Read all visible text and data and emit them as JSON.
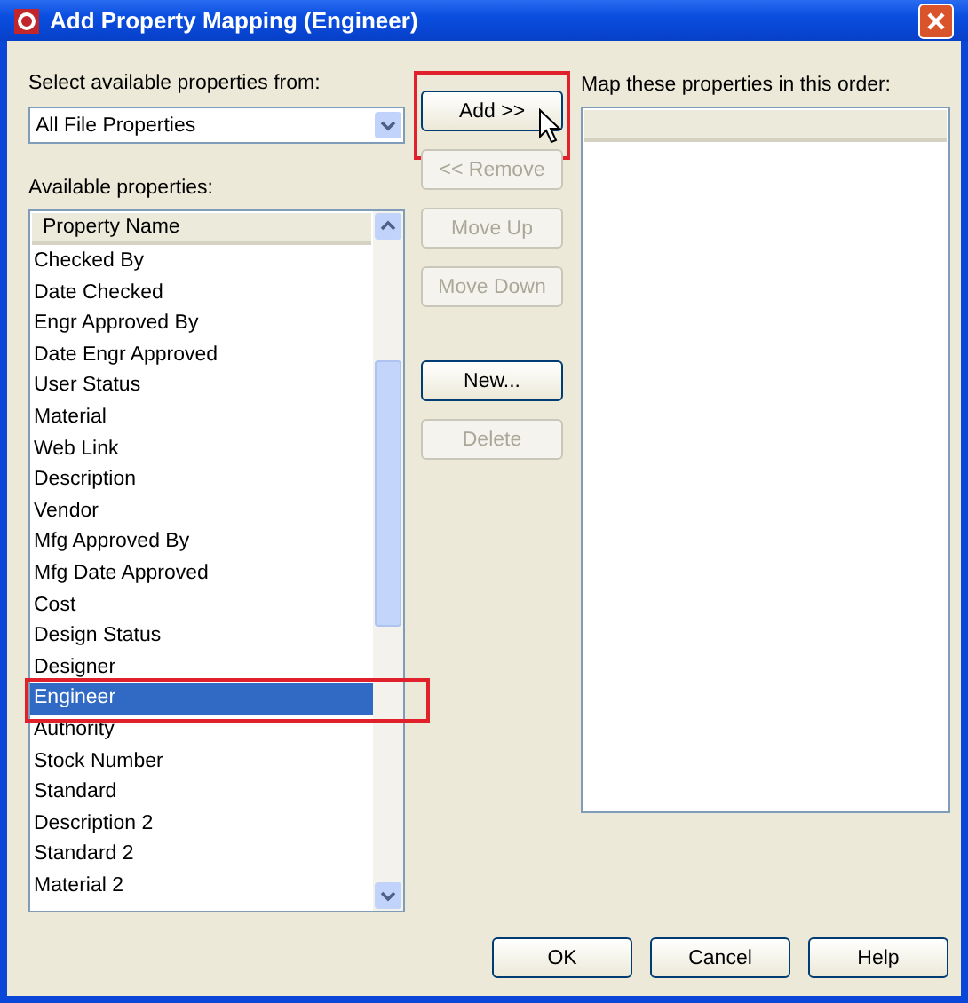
{
  "window": {
    "title": "Add Property Mapping (Engineer)"
  },
  "source": {
    "label": "Select available properties from:",
    "value": "All File Properties"
  },
  "available": {
    "label": "Available properties:",
    "header": "Property Name",
    "items": [
      {
        "name": "Checked By",
        "selected": false,
        "highlighted": false
      },
      {
        "name": "Date Checked",
        "selected": false,
        "highlighted": false
      },
      {
        "name": "Engr Approved By",
        "selected": false,
        "highlighted": false
      },
      {
        "name": "Date Engr Approved",
        "selected": false,
        "highlighted": false
      },
      {
        "name": "User Status",
        "selected": false,
        "highlighted": false
      },
      {
        "name": "Material",
        "selected": false,
        "highlighted": false
      },
      {
        "name": "Web Link",
        "selected": false,
        "highlighted": false
      },
      {
        "name": "Description",
        "selected": false,
        "highlighted": false
      },
      {
        "name": "Vendor",
        "selected": false,
        "highlighted": false
      },
      {
        "name": "Mfg Approved By",
        "selected": false,
        "highlighted": false
      },
      {
        "name": "Mfg Date Approved",
        "selected": false,
        "highlighted": false
      },
      {
        "name": "Cost",
        "selected": false,
        "highlighted": false
      },
      {
        "name": "Design Status",
        "selected": false,
        "highlighted": false
      },
      {
        "name": "Designer",
        "selected": false,
        "highlighted": false
      },
      {
        "name": "Engineer",
        "selected": true,
        "highlighted": true
      },
      {
        "name": "Authority",
        "selected": false,
        "highlighted": false
      },
      {
        "name": "Stock Number",
        "selected": false,
        "highlighted": false
      },
      {
        "name": "Standard",
        "selected": false,
        "highlighted": false
      },
      {
        "name": "Description 2",
        "selected": false,
        "highlighted": false
      },
      {
        "name": "Standard 2",
        "selected": false,
        "highlighted": false
      },
      {
        "name": "Material 2",
        "selected": false,
        "highlighted": false
      }
    ]
  },
  "actions": [
    {
      "label": "Add >>",
      "disabled": false,
      "highlighted": true
    },
    {
      "label": "<< Remove",
      "disabled": true,
      "highlighted": false
    },
    {
      "label": "Move Up",
      "disabled": true,
      "highlighted": false
    },
    {
      "label": "Move Down",
      "disabled": true,
      "highlighted": false
    }
  ],
  "edit_actions": [
    {
      "label": "New...",
      "disabled": false,
      "highlighted": false
    },
    {
      "label": "Delete",
      "disabled": true,
      "highlighted": false
    }
  ],
  "mapping": {
    "label": "Map these properties in this order:"
  },
  "buttons": [
    "OK",
    "Cancel",
    "Help"
  ]
}
